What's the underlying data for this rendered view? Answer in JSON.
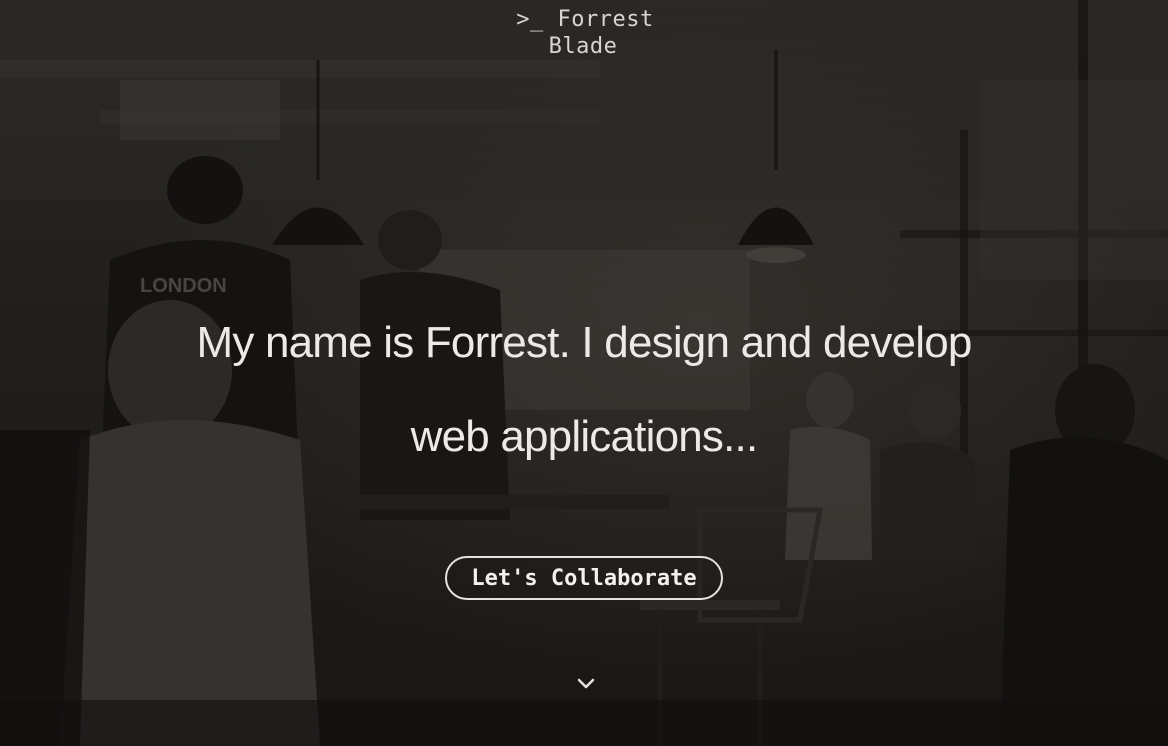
{
  "brand": {
    "prompt_symbol": ">_",
    "first_name": "Forrest",
    "last_name": "Blade"
  },
  "hero": {
    "headline_line1": "My name is Forrest. I design and develop",
    "headline_line2": "web applications...",
    "cta_label": "Let's Collaborate",
    "scroll_icon": "chevron-down-icon",
    "background_image": "café interior photo",
    "poster_text": "LONDON"
  },
  "colors": {
    "text": "#ece9e6",
    "overlay": "#1e1c1b",
    "button_border": "#e6e2de"
  }
}
